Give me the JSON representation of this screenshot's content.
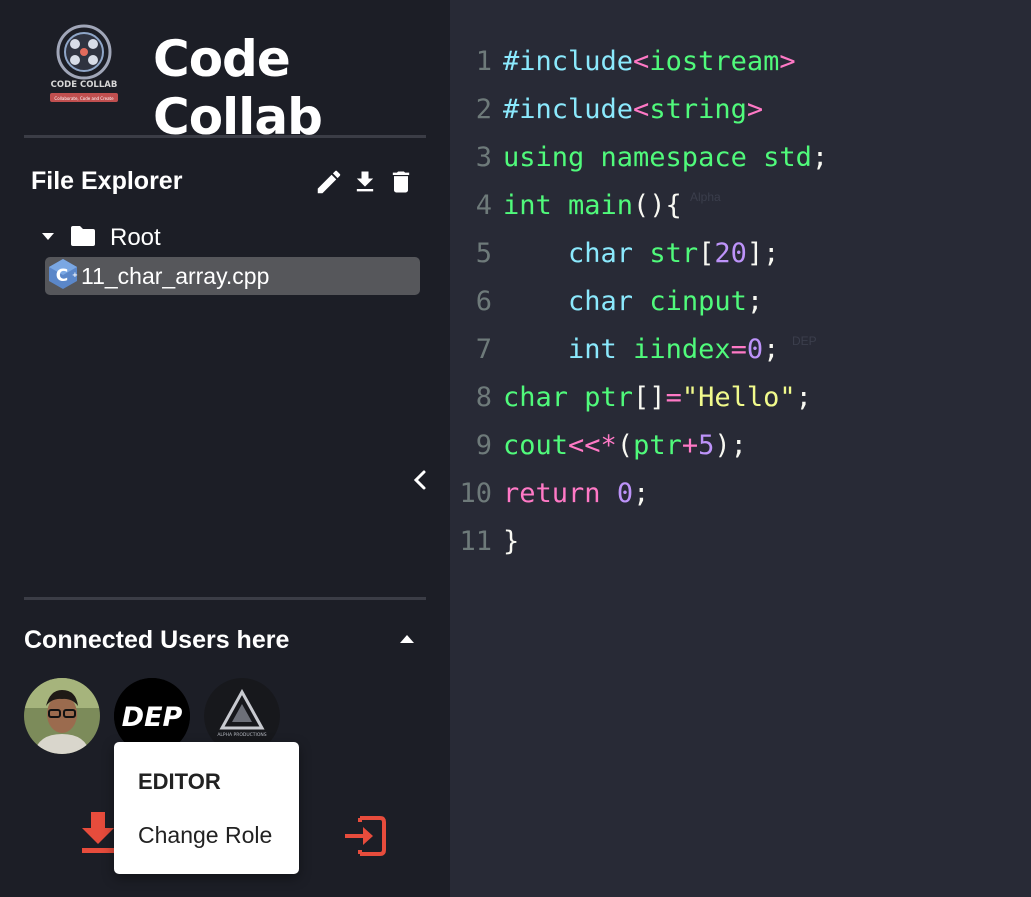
{
  "app": {
    "title": "Code Collab",
    "logo_text": "CODE COLLAB",
    "logo_tagline": "Collaborate, Code and Create"
  },
  "file_explorer": {
    "title": "File Explorer",
    "tools": [
      "pencil-icon",
      "download-icon",
      "trash-icon"
    ],
    "root_label": "Root",
    "files": [
      {
        "name": "11_char_array.cpp",
        "icon": "cpp-file-icon",
        "selected": true
      }
    ]
  },
  "connected_users": {
    "title": "Connected Users here",
    "users": [
      {
        "name": "user-photo"
      },
      {
        "name": "DEP",
        "label": "DEP"
      },
      {
        "name": "Alpha",
        "label": "ALPHA PRODUCTIONS"
      }
    ],
    "menu": {
      "role": "EDITOR",
      "action": "Change Role"
    }
  },
  "editor": {
    "line_numbers": [
      "1",
      "2",
      "3",
      "4",
      "5",
      "6",
      "7",
      "8",
      "9",
      "10",
      "11"
    ],
    "cursor_labels": {
      "alpha": "Alpha",
      "dep": "DEP"
    }
  },
  "colors": {
    "accent_red": "#e74c3c",
    "editor_bg": "#282a36",
    "sidebar_bg": "#1c1e26"
  }
}
